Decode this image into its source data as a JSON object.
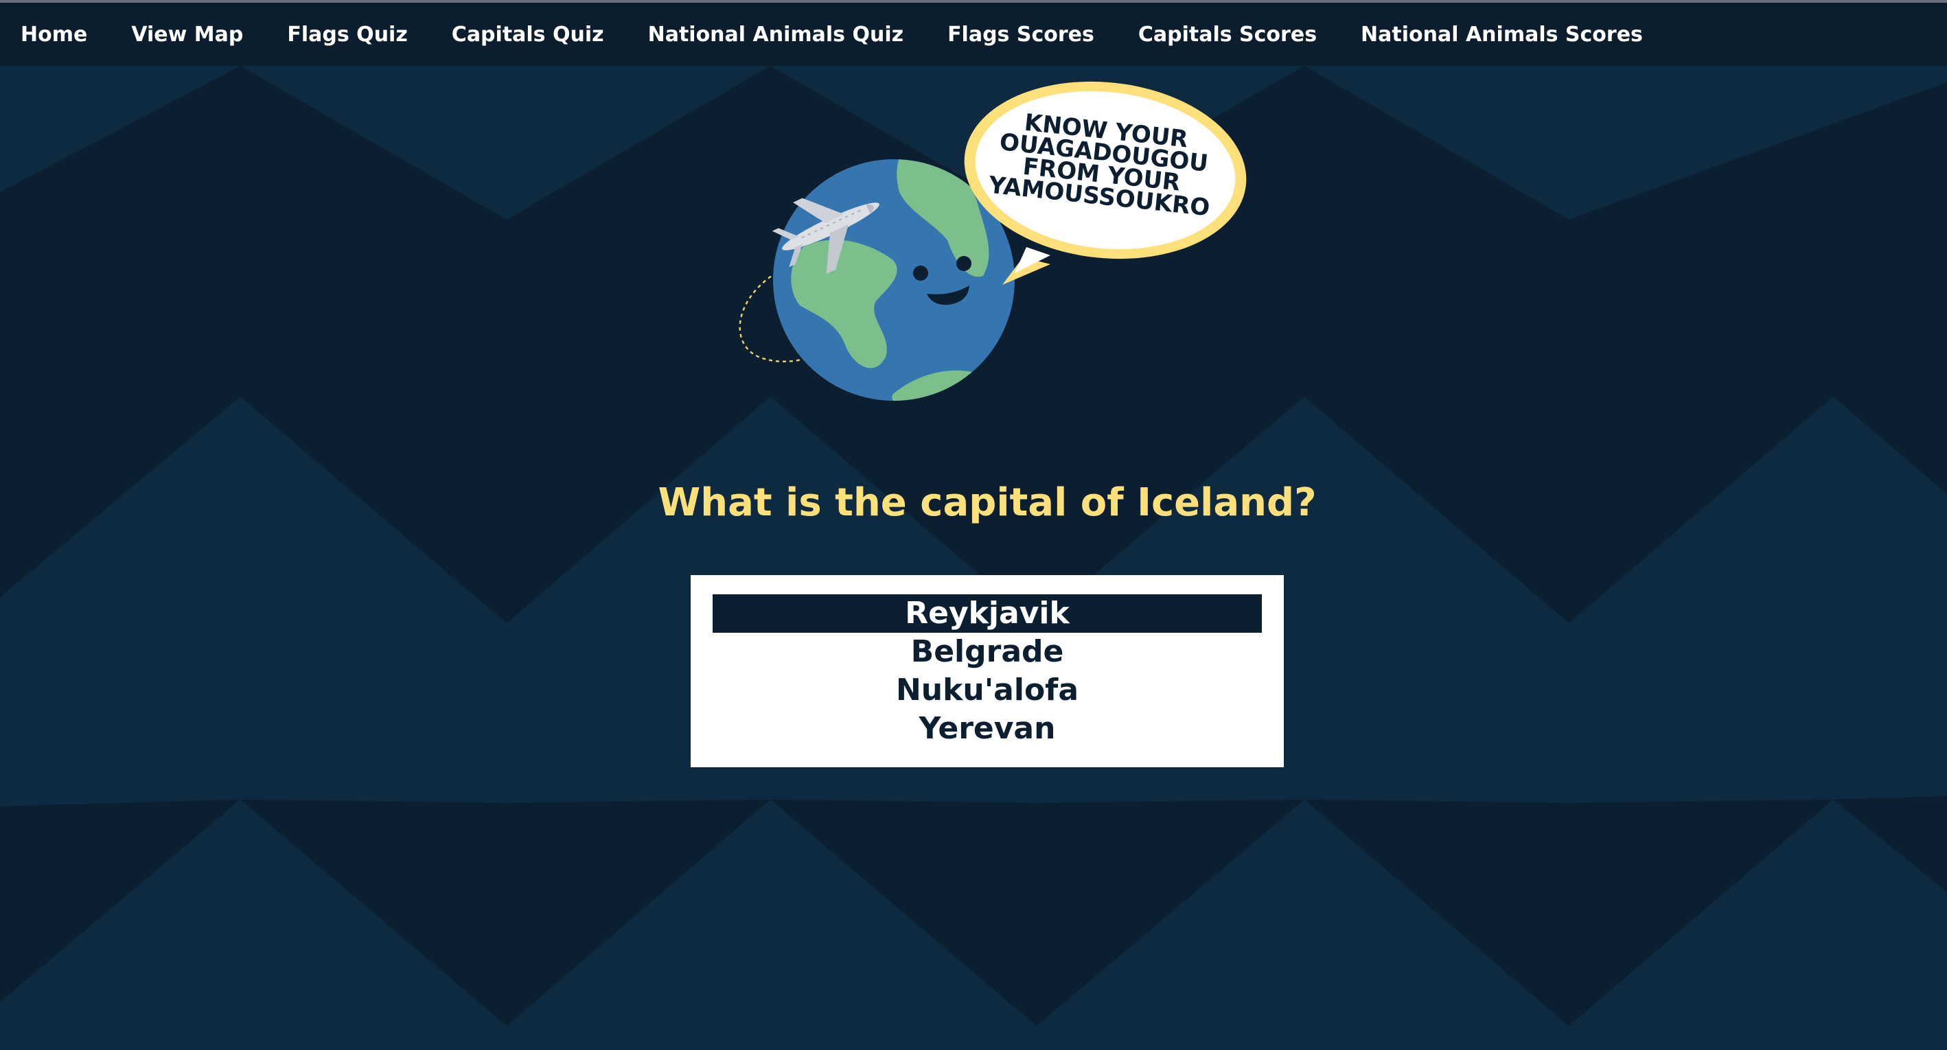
{
  "nav": {
    "items": [
      {
        "label": "Home"
      },
      {
        "label": "View Map"
      },
      {
        "label": "Flags Quiz"
      },
      {
        "label": "Capitals Quiz"
      },
      {
        "label": "National Animals Quiz"
      },
      {
        "label": "Flags Scores"
      },
      {
        "label": "Capitals Scores"
      },
      {
        "label": "National Animals Scores"
      }
    ]
  },
  "logo": {
    "bubble_lines": [
      "KNOW YOUR",
      "OUAGADOUGOU",
      "FROM YOUR",
      "YAMOUSSOUKRO"
    ]
  },
  "quiz": {
    "question": "What is the capital of Iceland?",
    "options": [
      {
        "label": "Reykjavik",
        "selected": true
      },
      {
        "label": "Belgrade",
        "selected": false
      },
      {
        "label": "Nuku'alofa",
        "selected": false
      },
      {
        "label": "Yerevan",
        "selected": false
      }
    ]
  },
  "colors": {
    "background": "#0b1f31",
    "chevron": "#0d2a40",
    "nav_background": "#0c1d2d",
    "accent_yellow": "#fde07a",
    "ocean": "#3575b0",
    "land": "#7cbf8c"
  }
}
